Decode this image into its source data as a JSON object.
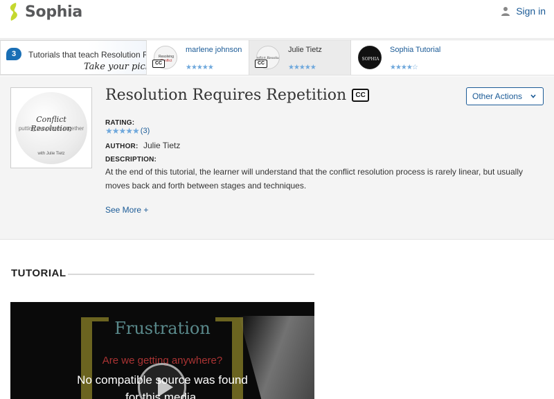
{
  "header": {
    "logo_text": "Sophia",
    "signin_label": "Sign in"
  },
  "tutorial_strip": {
    "count": "3",
    "intro_text": "Tutorials that teach Resolution R",
    "pick_text": "Take your pick:",
    "cards": [
      {
        "name": "marlene johnson",
        "stars": "★★★★★",
        "active": false,
        "cc": "CC"
      },
      {
        "name": "Julie Tietz",
        "stars": "★★★★★",
        "active": true,
        "cc": "CC"
      },
      {
        "name": "Sophia Tutorial",
        "stars": "★★★★☆",
        "active": false,
        "thumb_text": "SOPHIA"
      }
    ]
  },
  "tutorial": {
    "cover_title": "Conflict Resolution",
    "cover_subtitle": "putting the pieces together",
    "cover_by": "with Julie Tietz",
    "title": "Resolution Requires Repetition",
    "cc_label": "CC",
    "other_actions_label": "Other Actions",
    "rating_label": "RATING:",
    "rating_stars": "★★★★★",
    "rating_count": "(3)",
    "author_label": "AUTHOR:",
    "author_name": "Julie Tietz",
    "description_label": "DESCRIPTION:",
    "description": "At the end of this tutorial, the learner will understand that the conflict resolution process is rarely linear, but usually moves back and forth between stages and techniques.",
    "see_more_label": "See More +"
  },
  "section": {
    "heading": "TUTORIAL"
  },
  "player": {
    "slide_title": "Frustration",
    "slide_subtitle": "Are we getting anywhere?",
    "error_line1": "No compatible source was found",
    "error_line2": "for this media."
  },
  "colors": {
    "brand_green": "#c5d82f",
    "link_blue": "#1a5a96",
    "star_blue": "#6fa8dc"
  }
}
